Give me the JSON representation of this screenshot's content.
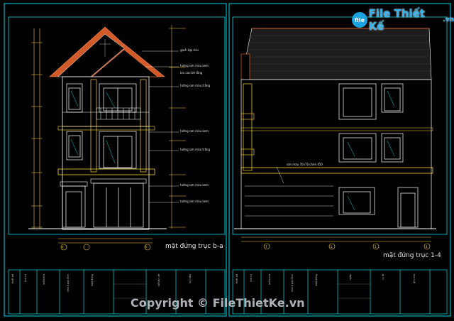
{
  "watermark": {
    "logo_text": "File Thiết Kế",
    "logo_suffix": ".vn",
    "copyright": "Copyright © FileThietKe.vn"
  },
  "left_sheet": {
    "title": "mặt đứng trục b-a",
    "annotations": [
      "gạch lợp mái",
      "tường sơn màu kem",
      "lan can bê tông",
      "tường sơn màu trắng",
      "tường sơn màu kem",
      "tường sơn màu trắng",
      "tường sơn màu kem",
      "tường sơn màu kem"
    ],
    "axis_labels": [
      "a",
      "b"
    ]
  },
  "right_sheet": {
    "title": "mặt đứng trục 1-4",
    "annotation": "sơn màu 70x70 chìm 450",
    "axis_labels": [
      "1",
      "2",
      "3",
      "4"
    ]
  },
  "title_block": {
    "cells": [
      "thiết kế",
      "chủ trì",
      "kiểm tra",
      "nhà ở gia đình",
      "mặt đứng",
      "số bản vẽ",
      "ký hiệu",
      "ngày",
      "tỷ lệ",
      "ghi chú"
    ]
  },
  "colors": {
    "background": "#000000",
    "frame": "#00d9e8",
    "roof": "#d15a2a",
    "wall": "#ffffff",
    "accent": "#ffd23a"
  }
}
